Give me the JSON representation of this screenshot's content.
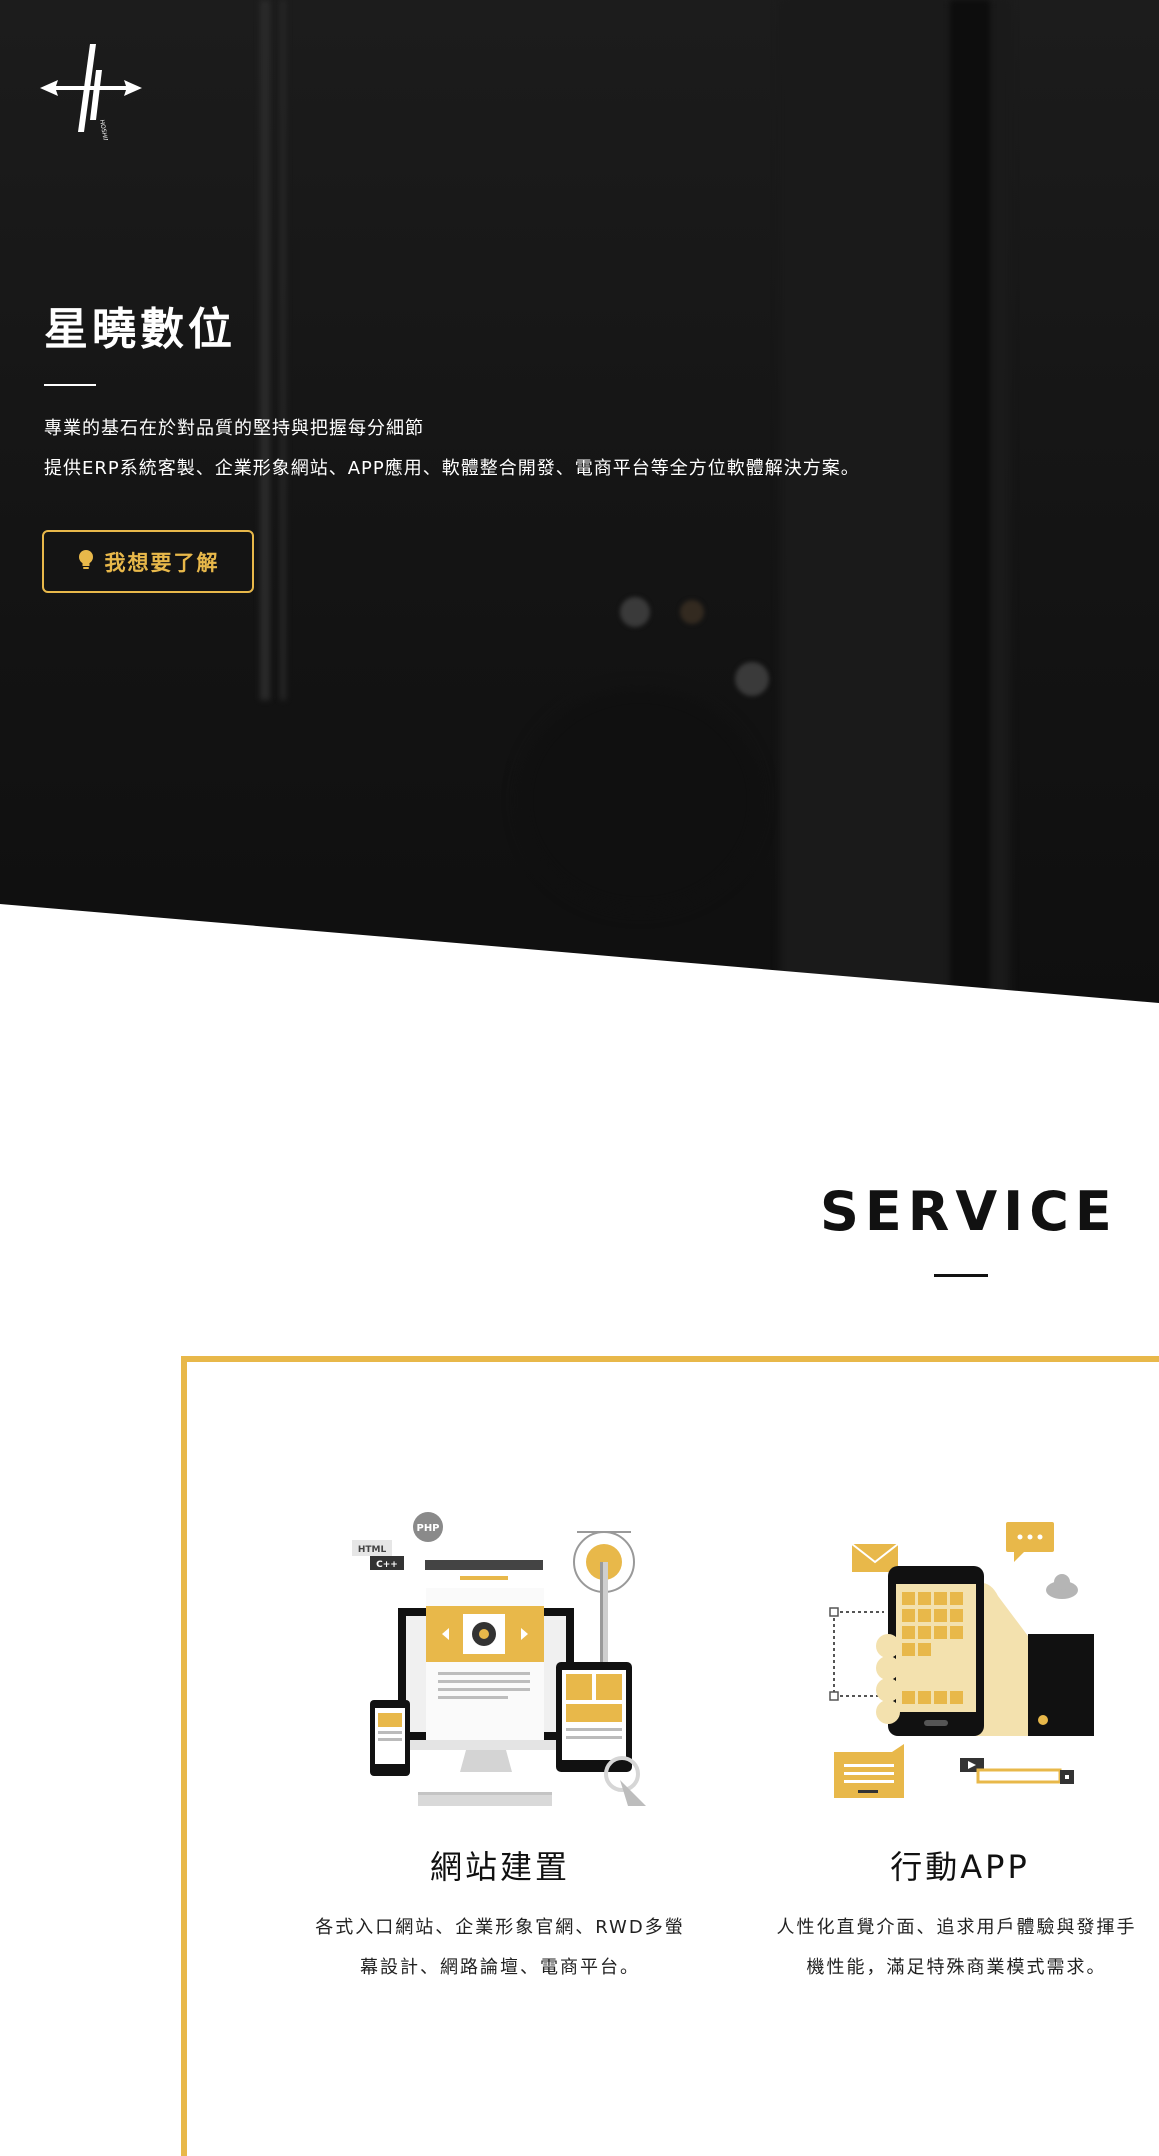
{
  "hero": {
    "logo_icon": "hoshinet-logo-icon",
    "title": "星曉數位",
    "line1": "專業的基石在於對品質的堅持與把握每分細節",
    "line2": "提供ERP系統客製、企業形象網站、APP應用、軟體整合開發、電商平台等全方位軟體解決方案。",
    "cta_icon": "lightbulb-icon",
    "cta_label": "我想要了解",
    "accent_color": "#e8b84a"
  },
  "service": {
    "heading": "SERVICE",
    "items": [
      {
        "icon": "website-devices-icon",
        "title": "網站建置",
        "desc_line1": "各式入口網站、企業形象官網、RWD多螢",
        "desc_line2": "幕設計、網路論壇、電商平台。",
        "badge_php": "PHP",
        "badge_html": "HTML",
        "badge_cpp": "C++"
      },
      {
        "icon": "mobile-app-hand-icon",
        "title": "行動APP",
        "desc_line1": "人性化直覺介面、追求用戶體驗與發揮手",
        "desc_line2": "機性能，滿足特殊商業模式需求。"
      }
    ]
  }
}
